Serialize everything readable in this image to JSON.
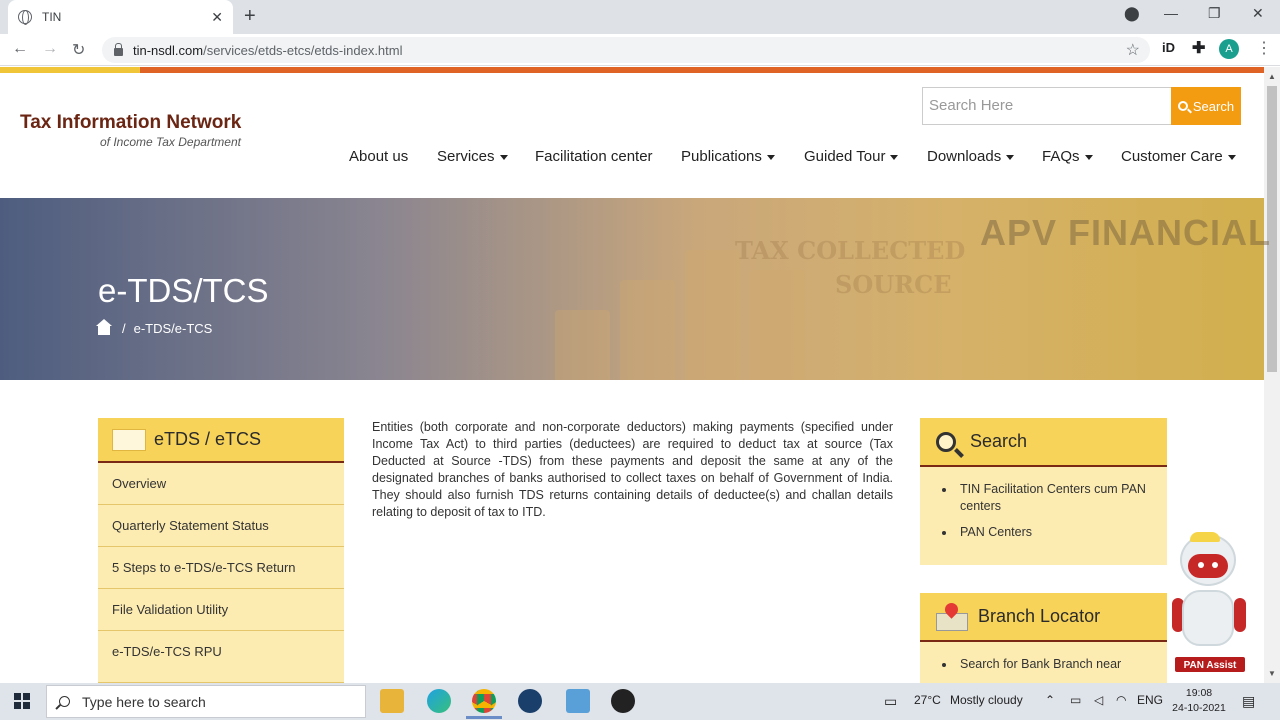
{
  "browser": {
    "tab_title": "TIN",
    "tab_close": "✕",
    "new_tab": "+",
    "url_host": "tin-nsdl.com",
    "url_path": "/services/etds-etcs/etds-index.html",
    "avatar_letter": "A",
    "ext_id_label": "iD"
  },
  "header": {
    "logo_title": "Tax Information Network",
    "logo_subtitle": "of Income Tax Department",
    "search_placeholder": "Search Here",
    "search_button": "Search"
  },
  "nav": [
    {
      "label": "About us",
      "dropdown": false
    },
    {
      "label": "Services",
      "dropdown": true
    },
    {
      "label": "Facilitation center",
      "dropdown": false
    },
    {
      "label": "Publications",
      "dropdown": true
    },
    {
      "label": "Guided Tour",
      "dropdown": true
    },
    {
      "label": "Downloads",
      "dropdown": true
    },
    {
      "label": "FAQs",
      "dropdown": true
    },
    {
      "label": "Customer Care",
      "dropdown": true
    }
  ],
  "hero": {
    "title": "e-TDS/TCS",
    "breadcrumb_separator": "/",
    "breadcrumb_current": "e-TDS/e-TCS",
    "watermark_brand": "APV FINANCIAL",
    "watermark_line1": "TAX COLLECTED",
    "watermark_line2": "SOURCE"
  },
  "sidebar": {
    "heading": "eTDS / eTCS",
    "items": [
      "Overview",
      "Quarterly Statement Status",
      "5 Steps to e-TDS/e-TCS Return",
      "File Validation Utility",
      "e-TDS/e-TCS RPU"
    ]
  },
  "main": {
    "intro": "Entities (both corporate and non-corporate deductors) making payments (specified under Income Tax Act) to third parties (deductees) are required to deduct tax at source (Tax Deducted at Source -TDS) from these payments and deposit the same at any of the designated branches of banks authorised to collect taxes on behalf of Government of India. They should also furnish TDS returns containing details of deductee(s) and challan details relating to deposit of tax to ITD."
  },
  "widgets": {
    "search": {
      "title": "Search",
      "links": [
        "TIN Facilitation Centers cum PAN centers",
        "PAN Centers"
      ]
    },
    "branch": {
      "title": "Branch Locator",
      "links": [
        "Search for Bank Branch near"
      ]
    }
  },
  "assistant": {
    "label": "PAN Assist"
  },
  "taskbar": {
    "search_placeholder": "Type here to search",
    "temperature": "27°C",
    "weather": "Mostly cloudy",
    "language": "ENG",
    "time": "19:08",
    "date": "24-10-2021"
  },
  "colors": {
    "accent_orange": "#f39c12",
    "panel_yellow": "#f7d35a",
    "panel_light": "#fdecb2",
    "brand_maroon": "#6b2513"
  }
}
